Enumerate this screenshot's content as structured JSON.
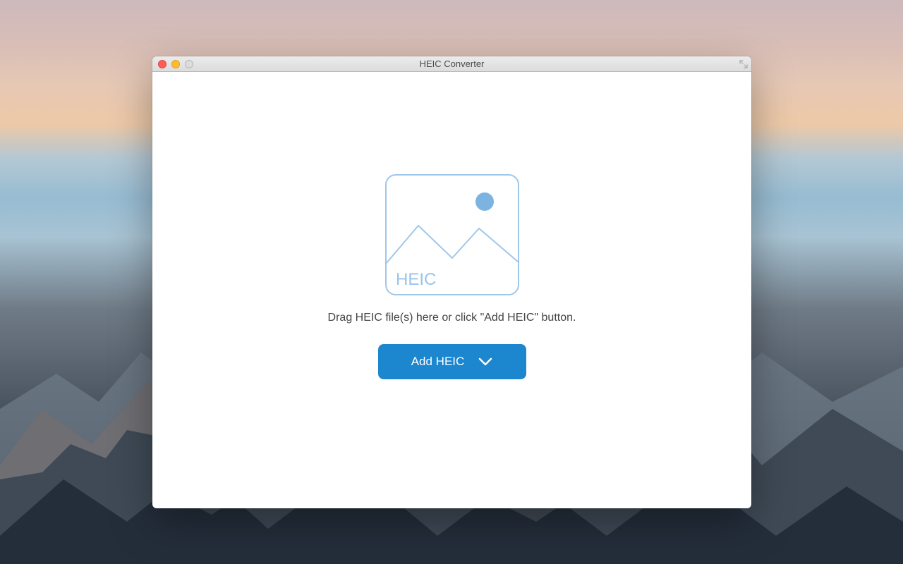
{
  "window": {
    "title": "HEIC Converter"
  },
  "main": {
    "placeholder_icon_label": "HEIC",
    "instruction": "Drag HEIC file(s) here or click \"Add HEIC\" button.",
    "add_button_label": "Add HEIC"
  },
  "colors": {
    "accent": "#1c86cf",
    "icon_stroke": "#9fc7ea"
  }
}
